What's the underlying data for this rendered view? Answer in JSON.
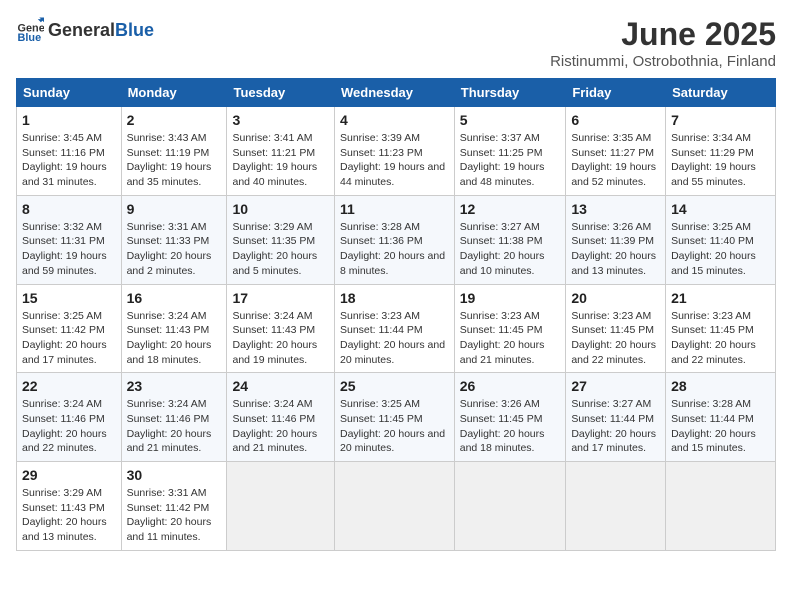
{
  "logo": {
    "general": "General",
    "blue": "Blue"
  },
  "title": "June 2025",
  "subtitle": "Ristinummi, Ostrobothnia, Finland",
  "headers": [
    "Sunday",
    "Monday",
    "Tuesday",
    "Wednesday",
    "Thursday",
    "Friday",
    "Saturday"
  ],
  "weeks": [
    [
      {
        "day": "1",
        "sunrise": "Sunrise: 3:45 AM",
        "sunset": "Sunset: 11:16 PM",
        "daylight": "Daylight: 19 hours and 31 minutes."
      },
      {
        "day": "2",
        "sunrise": "Sunrise: 3:43 AM",
        "sunset": "Sunset: 11:19 PM",
        "daylight": "Daylight: 19 hours and 35 minutes."
      },
      {
        "day": "3",
        "sunrise": "Sunrise: 3:41 AM",
        "sunset": "Sunset: 11:21 PM",
        "daylight": "Daylight: 19 hours and 40 minutes."
      },
      {
        "day": "4",
        "sunrise": "Sunrise: 3:39 AM",
        "sunset": "Sunset: 11:23 PM",
        "daylight": "Daylight: 19 hours and 44 minutes."
      },
      {
        "day": "5",
        "sunrise": "Sunrise: 3:37 AM",
        "sunset": "Sunset: 11:25 PM",
        "daylight": "Daylight: 19 hours and 48 minutes."
      },
      {
        "day": "6",
        "sunrise": "Sunrise: 3:35 AM",
        "sunset": "Sunset: 11:27 PM",
        "daylight": "Daylight: 19 hours and 52 minutes."
      },
      {
        "day": "7",
        "sunrise": "Sunrise: 3:34 AM",
        "sunset": "Sunset: 11:29 PM",
        "daylight": "Daylight: 19 hours and 55 minutes."
      }
    ],
    [
      {
        "day": "8",
        "sunrise": "Sunrise: 3:32 AM",
        "sunset": "Sunset: 11:31 PM",
        "daylight": "Daylight: 19 hours and 59 minutes."
      },
      {
        "day": "9",
        "sunrise": "Sunrise: 3:31 AM",
        "sunset": "Sunset: 11:33 PM",
        "daylight": "Daylight: 20 hours and 2 minutes."
      },
      {
        "day": "10",
        "sunrise": "Sunrise: 3:29 AM",
        "sunset": "Sunset: 11:35 PM",
        "daylight": "Daylight: 20 hours and 5 minutes."
      },
      {
        "day": "11",
        "sunrise": "Sunrise: 3:28 AM",
        "sunset": "Sunset: 11:36 PM",
        "daylight": "Daylight: 20 hours and 8 minutes."
      },
      {
        "day": "12",
        "sunrise": "Sunrise: 3:27 AM",
        "sunset": "Sunset: 11:38 PM",
        "daylight": "Daylight: 20 hours and 10 minutes."
      },
      {
        "day": "13",
        "sunrise": "Sunrise: 3:26 AM",
        "sunset": "Sunset: 11:39 PM",
        "daylight": "Daylight: 20 hours and 13 minutes."
      },
      {
        "day": "14",
        "sunrise": "Sunrise: 3:25 AM",
        "sunset": "Sunset: 11:40 PM",
        "daylight": "Daylight: 20 hours and 15 minutes."
      }
    ],
    [
      {
        "day": "15",
        "sunrise": "Sunrise: 3:25 AM",
        "sunset": "Sunset: 11:42 PM",
        "daylight": "Daylight: 20 hours and 17 minutes."
      },
      {
        "day": "16",
        "sunrise": "Sunrise: 3:24 AM",
        "sunset": "Sunset: 11:43 PM",
        "daylight": "Daylight: 20 hours and 18 minutes."
      },
      {
        "day": "17",
        "sunrise": "Sunrise: 3:24 AM",
        "sunset": "Sunset: 11:43 PM",
        "daylight": "Daylight: 20 hours and 19 minutes."
      },
      {
        "day": "18",
        "sunrise": "Sunrise: 3:23 AM",
        "sunset": "Sunset: 11:44 PM",
        "daylight": "Daylight: 20 hours and 20 minutes."
      },
      {
        "day": "19",
        "sunrise": "Sunrise: 3:23 AM",
        "sunset": "Sunset: 11:45 PM",
        "daylight": "Daylight: 20 hours and 21 minutes."
      },
      {
        "day": "20",
        "sunrise": "Sunrise: 3:23 AM",
        "sunset": "Sunset: 11:45 PM",
        "daylight": "Daylight: 20 hours and 22 minutes."
      },
      {
        "day": "21",
        "sunrise": "Sunrise: 3:23 AM",
        "sunset": "Sunset: 11:45 PM",
        "daylight": "Daylight: 20 hours and 22 minutes."
      }
    ],
    [
      {
        "day": "22",
        "sunrise": "Sunrise: 3:24 AM",
        "sunset": "Sunset: 11:46 PM",
        "daylight": "Daylight: 20 hours and 22 minutes."
      },
      {
        "day": "23",
        "sunrise": "Sunrise: 3:24 AM",
        "sunset": "Sunset: 11:46 PM",
        "daylight": "Daylight: 20 hours and 21 minutes."
      },
      {
        "day": "24",
        "sunrise": "Sunrise: 3:24 AM",
        "sunset": "Sunset: 11:46 PM",
        "daylight": "Daylight: 20 hours and 21 minutes."
      },
      {
        "day": "25",
        "sunrise": "Sunrise: 3:25 AM",
        "sunset": "Sunset: 11:45 PM",
        "daylight": "Daylight: 20 hours and 20 minutes."
      },
      {
        "day": "26",
        "sunrise": "Sunrise: 3:26 AM",
        "sunset": "Sunset: 11:45 PM",
        "daylight": "Daylight: 20 hours and 18 minutes."
      },
      {
        "day": "27",
        "sunrise": "Sunrise: 3:27 AM",
        "sunset": "Sunset: 11:44 PM",
        "daylight": "Daylight: 20 hours and 17 minutes."
      },
      {
        "day": "28",
        "sunrise": "Sunrise: 3:28 AM",
        "sunset": "Sunset: 11:44 PM",
        "daylight": "Daylight: 20 hours and 15 minutes."
      }
    ],
    [
      {
        "day": "29",
        "sunrise": "Sunrise: 3:29 AM",
        "sunset": "Sunset: 11:43 PM",
        "daylight": "Daylight: 20 hours and 13 minutes."
      },
      {
        "day": "30",
        "sunrise": "Sunrise: 3:31 AM",
        "sunset": "Sunset: 11:42 PM",
        "daylight": "Daylight: 20 hours and 11 minutes."
      },
      null,
      null,
      null,
      null,
      null
    ]
  ],
  "colors": {
    "header_bg": "#1a5fa8",
    "header_text": "#ffffff",
    "border": "#cccccc",
    "empty_cell": "#f0f0f0"
  }
}
